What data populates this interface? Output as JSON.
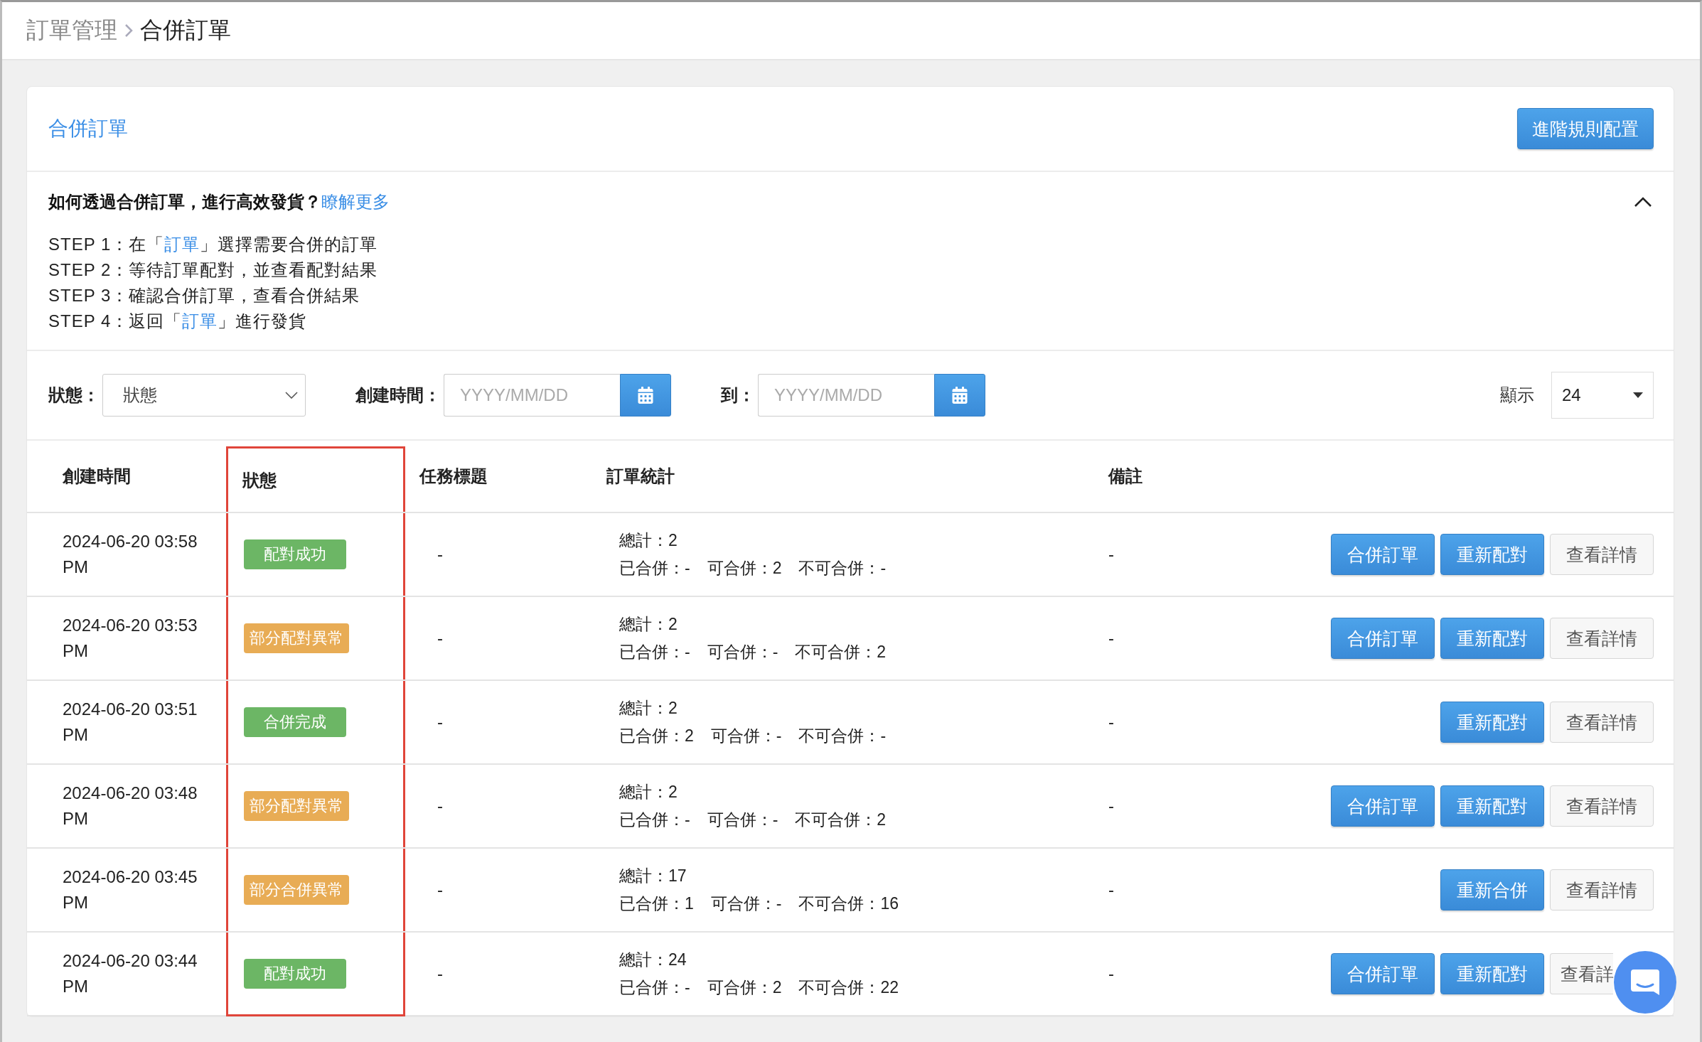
{
  "breadcrumb": {
    "parent": "訂單管理",
    "current": "合併訂單"
  },
  "card": {
    "title": "合併訂單",
    "rules_button": "進階規則配置"
  },
  "help": {
    "expanded": true,
    "question": "如何透過合併訂單，進行高效發貨？",
    "link": "瞭解更多",
    "steps": [
      [
        {
          "text": "STEP 1：在「"
        },
        {
          "text": "訂單",
          "link": true
        },
        {
          "text": "」選擇需要合併的訂單"
        }
      ],
      [
        {
          "text": "STEP 2：等待訂單配對，並查看配對結果"
        }
      ],
      [
        {
          "text": "STEP 3：確認合併訂單，查看合併結果"
        }
      ],
      [
        {
          "text": "STEP 4：返回「"
        },
        {
          "text": "訂單",
          "link": true
        },
        {
          "text": "」進行發貨"
        }
      ]
    ]
  },
  "filters": {
    "status_label": "狀態：",
    "status_value": "狀態",
    "created_label": "創建時間：",
    "from_placeholder": "YYYY/MM/DD",
    "to_label": "到：",
    "to_placeholder": "YYYY/MM/DD",
    "show_label": "顯示",
    "show_value": "24"
  },
  "table": {
    "columns": [
      {
        "label": "創建時間",
        "highlighted": false
      },
      {
        "label": "狀態",
        "highlighted": true
      },
      {
        "label": "任務標題",
        "highlighted": false
      },
      {
        "label": "訂單統計",
        "highlighted": false
      },
      {
        "label": "備註",
        "highlighted": false
      }
    ],
    "rows": [
      {
        "created": "2024-06-20 03:58 PM",
        "status": {
          "label": "配對成功",
          "color": "#6cb665"
        },
        "title": "-",
        "total": "總計：2",
        "merged": "已合併：-",
        "mergeable": "可合併：2",
        "unmergeable": "不可合併：-",
        "note": "-",
        "actions": [
          {
            "label": "合併訂單",
            "kind": "primary"
          },
          {
            "label": "重新配對",
            "kind": "primary"
          },
          {
            "label": "查看詳情",
            "kind": "default"
          }
        ]
      },
      {
        "created": "2024-06-20 03:53 PM",
        "status": {
          "label": "部分配對異常",
          "color": "#e8ac55"
        },
        "title": "-",
        "total": "總計：2",
        "merged": "已合併：-",
        "mergeable": "可合併：-",
        "unmergeable": "不可合併：2",
        "note": "-",
        "actions": [
          {
            "label": "合併訂單",
            "kind": "primary"
          },
          {
            "label": "重新配對",
            "kind": "primary"
          },
          {
            "label": "查看詳情",
            "kind": "default"
          }
        ]
      },
      {
        "created": "2024-06-20 03:51 PM",
        "status": {
          "label": "合併完成",
          "color": "#6cb665"
        },
        "title": "-",
        "total": "總計：2",
        "merged": "已合併：2",
        "mergeable": "可合併：-",
        "unmergeable": "不可合併：-",
        "note": "-",
        "actions": [
          {
            "label": "重新配對",
            "kind": "primary"
          },
          {
            "label": "查看詳情",
            "kind": "default"
          }
        ]
      },
      {
        "created": "2024-06-20 03:48 PM",
        "status": {
          "label": "部分配對異常",
          "color": "#e8ac55"
        },
        "title": "-",
        "total": "總計：2",
        "merged": "已合併：-",
        "mergeable": "可合併：-",
        "unmergeable": "不可合併：2",
        "note": "-",
        "actions": [
          {
            "label": "合併訂單",
            "kind": "primary"
          },
          {
            "label": "重新配對",
            "kind": "primary"
          },
          {
            "label": "查看詳情",
            "kind": "default"
          }
        ]
      },
      {
        "created": "2024-06-20 03:45 PM",
        "status": {
          "label": "部分合併異常",
          "color": "#e8ac55"
        },
        "title": "-",
        "total": "總計：17",
        "merged": "已合併：1",
        "mergeable": "可合併：-",
        "unmergeable": "不可合併：16",
        "note": "-",
        "actions": [
          {
            "label": "重新合併",
            "kind": "primary"
          },
          {
            "label": "查看詳情",
            "kind": "default"
          }
        ]
      },
      {
        "created": "2024-06-20 03:44 PM",
        "status": {
          "label": "配對成功",
          "color": "#6cb665"
        },
        "title": "-",
        "total": "總計：24",
        "merged": "已合併：-",
        "mergeable": "可合併：2",
        "unmergeable": "不可合併：22",
        "note": "-",
        "actions": [
          {
            "label": "合併訂單",
            "kind": "primary"
          },
          {
            "label": "重新配對",
            "kind": "primary"
          },
          {
            "label": "查看詳",
            "kind": "default"
          }
        ]
      }
    ]
  }
}
